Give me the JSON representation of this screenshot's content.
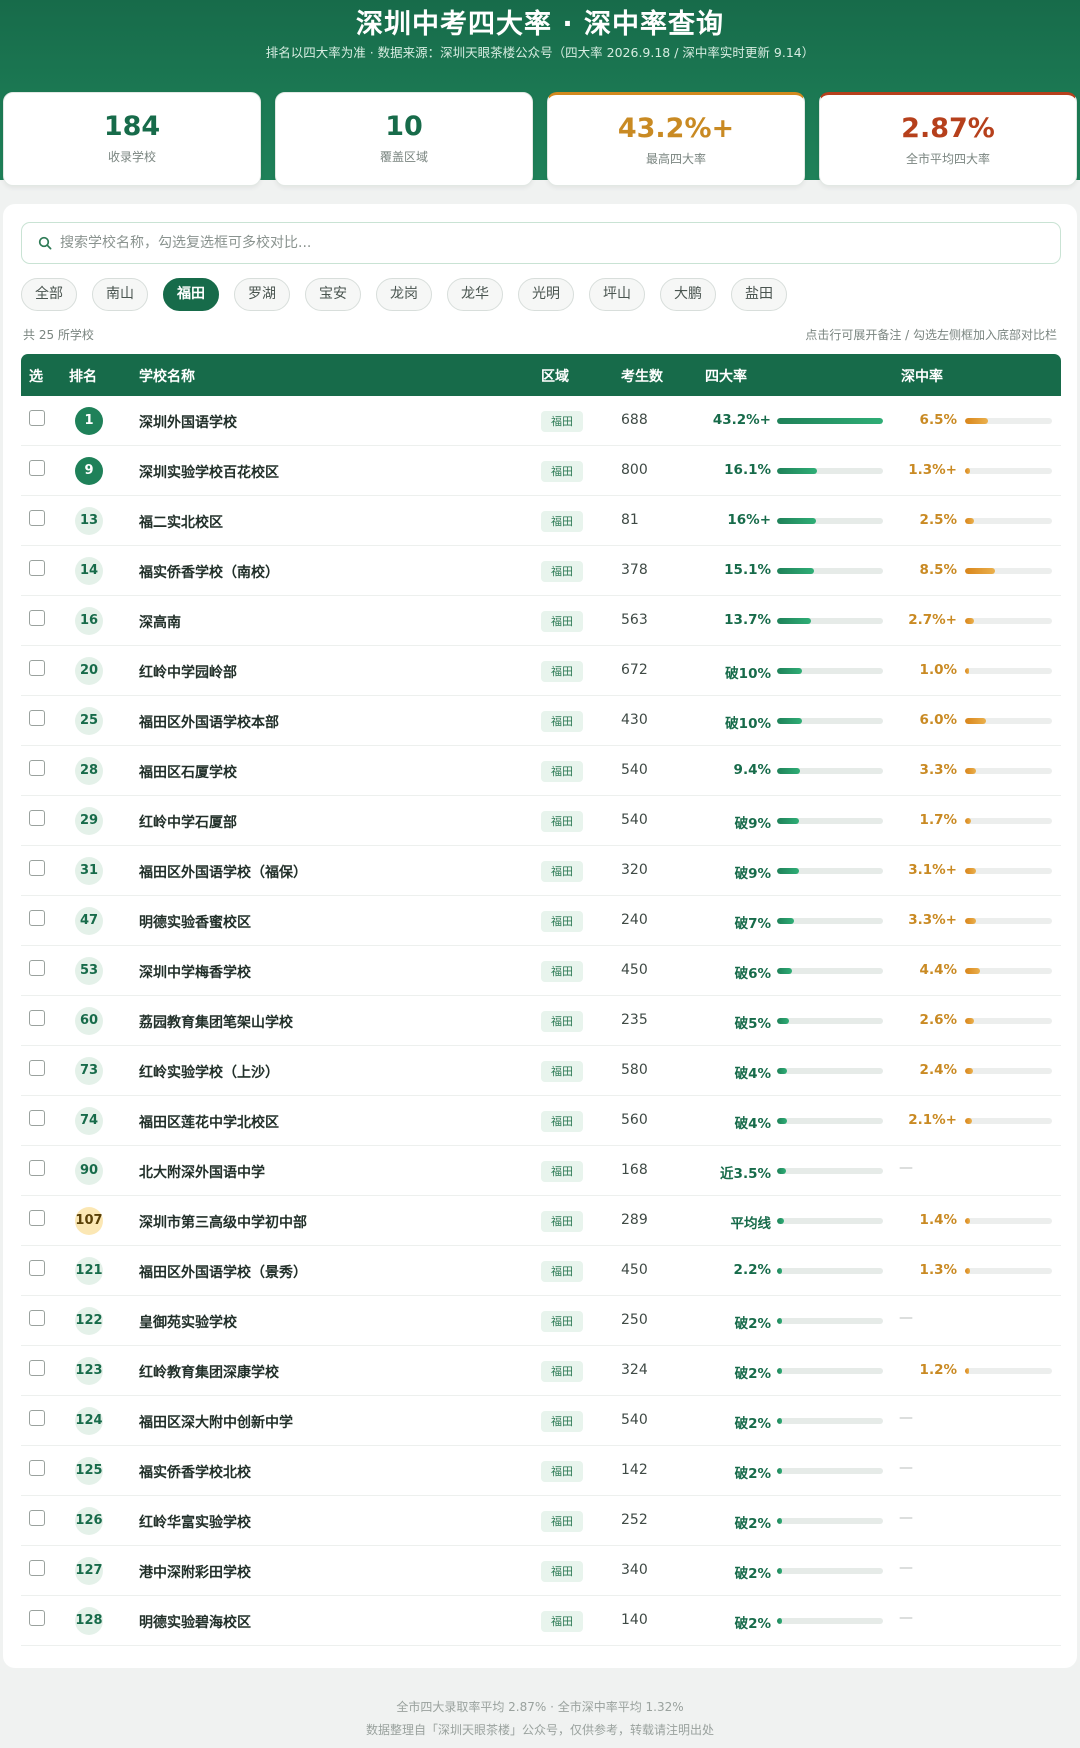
{
  "header": {
    "title": "深圳中考四大率 · 深中率查询",
    "subtitle": "排名以四大率为准 · 数据来源：深圳天眼茶楼公众号（四大率 2026.9.18 / 深中率实时更新 9.14）"
  },
  "stats": [
    {
      "value": "184",
      "label": "收录学校"
    },
    {
      "value": "10",
      "label": "覆盖区域"
    },
    {
      "value": "43.2%+",
      "label": "最高四大率"
    },
    {
      "value": "2.87%",
      "label": "全市平均四大率"
    }
  ],
  "search": {
    "placeholder": "搜索学校名称，勾选复选框可多校对比..."
  },
  "filters": [
    "全部",
    "南山",
    "福田",
    "罗湖",
    "宝安",
    "龙岗",
    "龙华",
    "光明",
    "坪山",
    "大鹏",
    "盐田"
  ],
  "active_filter": "福田",
  "count_text": "共 25 所学校",
  "hint_text": "点击行可展开备注 / 勾选左侧框加入底部对比栏",
  "table": {
    "headers": {
      "select": "选",
      "rank": "排名",
      "name": "学校名称",
      "district": "区域",
      "students": "考生数",
      "rate4": "四大率",
      "sz": "深中率"
    },
    "rows": [
      {
        "rank": "1",
        "name": "深圳外国语学校",
        "district": "福田",
        "students": "688",
        "rate4": "43.2%+",
        "rate4_value": 43.2,
        "sz": "6.5%",
        "sz_value": 6.5
      },
      {
        "rank": "9",
        "name": "深圳实验学校百花校区",
        "district": "福田",
        "students": "800",
        "rate4": "16.1%",
        "rate4_value": 16.1,
        "sz": "1.3%+",
        "sz_value": 1.3
      },
      {
        "rank": "13",
        "name": "福二实北校区",
        "district": "福田",
        "students": "81",
        "rate4": "16%+",
        "rate4_value": 16,
        "sz": "2.5%",
        "sz_value": 2.5
      },
      {
        "rank": "14",
        "name": "福实侨香学校（南校）",
        "district": "福田",
        "students": "378",
        "rate4": "15.1%",
        "rate4_value": 15.1,
        "sz": "8.5%",
        "sz_value": 8.5
      },
      {
        "rank": "16",
        "name": "深高南",
        "district": "福田",
        "students": "563",
        "rate4": "13.7%",
        "rate4_value": 13.7,
        "sz": "2.7%+",
        "sz_value": 2.7
      },
      {
        "rank": "20",
        "name": "红岭中学园岭部",
        "district": "福田",
        "students": "672",
        "rate4": "破10%",
        "rate4_value": 10,
        "sz": "1.0%",
        "sz_value": 1.0
      },
      {
        "rank": "25",
        "name": "福田区外国语学校本部",
        "district": "福田",
        "students": "430",
        "rate4": "破10%",
        "rate4_value": 10,
        "sz": "6.0%",
        "sz_value": 6.0
      },
      {
        "rank": "28",
        "name": "福田区石厦学校",
        "district": "福田",
        "students": "540",
        "rate4": "9.4%",
        "rate4_value": 9.4,
        "sz": "3.3%",
        "sz_value": 3.3
      },
      {
        "rank": "29",
        "name": "红岭中学石厦部",
        "district": "福田",
        "students": "540",
        "rate4": "破9%",
        "rate4_value": 9,
        "sz": "1.7%",
        "sz_value": 1.7
      },
      {
        "rank": "31",
        "name": "福田区外国语学校（福保）",
        "district": "福田",
        "students": "320",
        "rate4": "破9%",
        "rate4_value": 9,
        "sz": "3.1%+",
        "sz_value": 3.1
      },
      {
        "rank": "47",
        "name": "明德实验香蜜校区",
        "district": "福田",
        "students": "240",
        "rate4": "破7%",
        "rate4_value": 7,
        "sz": "3.3%+",
        "sz_value": 3.3
      },
      {
        "rank": "53",
        "name": "深圳中学梅香学校",
        "district": "福田",
        "students": "450",
        "rate4": "破6%",
        "rate4_value": 6,
        "sz": "4.4%",
        "sz_value": 4.4
      },
      {
        "rank": "60",
        "name": "荔园教育集团笔架山学校",
        "district": "福田",
        "students": "235",
        "rate4": "破5%",
        "rate4_value": 5,
        "sz": "2.6%",
        "sz_value": 2.6
      },
      {
        "rank": "73",
        "name": "红岭实验学校（上沙）",
        "district": "福田",
        "students": "580",
        "rate4": "破4%",
        "rate4_value": 4,
        "sz": "2.4%",
        "sz_value": 2.4
      },
      {
        "rank": "74",
        "name": "福田区莲花中学北校区",
        "district": "福田",
        "students": "560",
        "rate4": "破4%",
        "rate4_value": 4,
        "sz": "2.1%+",
        "sz_value": 2.1
      },
      {
        "rank": "90",
        "name": "北大附深外国语中学",
        "district": "福田",
        "students": "168",
        "rate4": "近3.5%",
        "rate4_value": 3.5,
        "sz": "—",
        "sz_value": null
      },
      {
        "rank": "107",
        "name": "深圳市第三高级中学初中部",
        "district": "福田",
        "students": "289",
        "rate4": "平均线",
        "rate4_value": 2.87,
        "sz": "1.4%",
        "sz_value": 1.4
      },
      {
        "rank": "121",
        "name": "福田区外国语学校（景秀）",
        "district": "福田",
        "students": "450",
        "rate4": "2.2%",
        "rate4_value": 2.2,
        "sz": "1.3%",
        "sz_value": 1.3
      },
      {
        "rank": "122",
        "name": "皇御苑实验学校",
        "district": "福田",
        "students": "250",
        "rate4": "破2%",
        "rate4_value": 2,
        "sz": "—",
        "sz_value": null
      },
      {
        "rank": "123",
        "name": "红岭教育集团深康学校",
        "district": "福田",
        "students": "324",
        "rate4": "破2%",
        "rate4_value": 2,
        "sz": "1.2%",
        "sz_value": 1.2
      },
      {
        "rank": "124",
        "name": "福田区深大附中创新中学",
        "district": "福田",
        "students": "540",
        "rate4": "破2%",
        "rate4_value": 2,
        "sz": "—",
        "sz_value": null
      },
      {
        "rank": "125",
        "name": "福实侨香学校北校",
        "district": "福田",
        "students": "142",
        "rate4": "破2%",
        "rate4_value": 2,
        "sz": "—",
        "sz_value": null
      },
      {
        "rank": "126",
        "name": "红岭华富实验学校",
        "district": "福田",
        "students": "252",
        "rate4": "破2%",
        "rate4_value": 2,
        "sz": "—",
        "sz_value": null
      },
      {
        "rank": "127",
        "name": "港中深附彩田学校",
        "district": "福田",
        "students": "340",
        "rate4": "破2%",
        "rate4_value": 2,
        "sz": "—",
        "sz_value": null
      },
      {
        "rank": "128",
        "name": "明德实验碧海校区",
        "district": "福田",
        "students": "140",
        "rate4": "破2%",
        "rate4_value": 2,
        "sz": "—",
        "sz_value": null
      }
    ]
  },
  "footer": {
    "line1": "全市四大录取率平均 2.87% · 全市深中率平均 1.32%",
    "line2": "数据整理自「深圳天眼茶楼」公众号，仅供参考，转载请注明出处"
  },
  "colors": {
    "primary": "#176b4a",
    "accent": "#c98a23",
    "danger": "#b6401c"
  }
}
